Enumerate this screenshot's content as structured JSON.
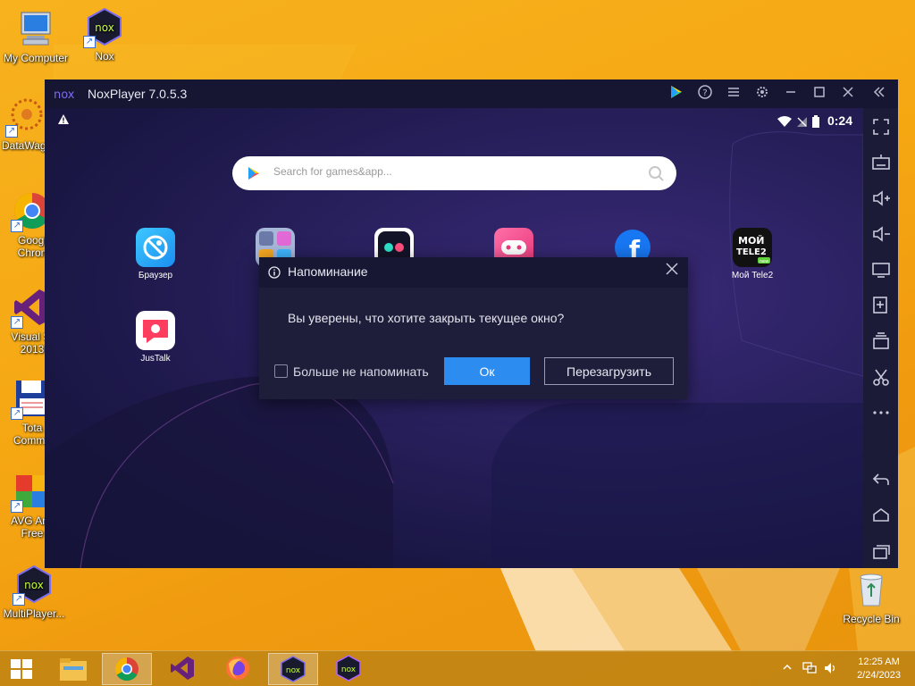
{
  "desktop": {
    "icons": [
      {
        "label": "My Computer"
      },
      {
        "label": "Nox"
      },
      {
        "label": "DataWag"
      },
      {
        "label": "Googl Chron"
      },
      {
        "label": "Visual St 2013"
      },
      {
        "label": "Tota Comma"
      },
      {
        "label": "AVG Anti Free"
      },
      {
        "label": "MultiPlayer..."
      },
      {
        "label": "Recycle Bin"
      }
    ],
    "icon_labels": {
      "my_computer": "My Computer",
      "nox": "Nox",
      "datawag": "DataWag",
      "chrome_1": "Googl",
      "chrome_2": "Chron",
      "vs_1": "Visual St",
      "vs_2": "2013",
      "tc_1": "Tota",
      "tc_2": "Comma",
      "avg_1": "AVG Anti",
      "avg_2": "Free",
      "multiplayer": "MultiPlayer...",
      "recycle": "Recycle Bin"
    }
  },
  "nox": {
    "logo": "nox",
    "title": "NoxPlayer 7.0.5.3",
    "status": {
      "time": "0:24"
    },
    "search": {
      "placeholder": "Search for games&app..."
    },
    "apps": [
      {
        "label": "Браузер"
      },
      {
        "label": "Мой Tele2"
      },
      {
        "label": "JusTalk"
      }
    ],
    "tele2_icon_text": {
      "line1": "МОЙ",
      "line2": "TELE2",
      "badge": "new"
    }
  },
  "dialog": {
    "title": "Напоминание",
    "message": "Вы уверены, что хотите закрыть текущее окно?",
    "checkbox_label": "Больше не напоминать",
    "ok_label": "Ок",
    "reload_label": "Перезагрузить"
  },
  "taskbar": {
    "clock_time": "12:25 AM",
    "clock_date": "2/24/2023",
    "nox_label": "nox"
  },
  "colors": {
    "accent": "#2d8cf0",
    "window_bg": "#1d1b3a",
    "desktop": "#f5a712"
  }
}
